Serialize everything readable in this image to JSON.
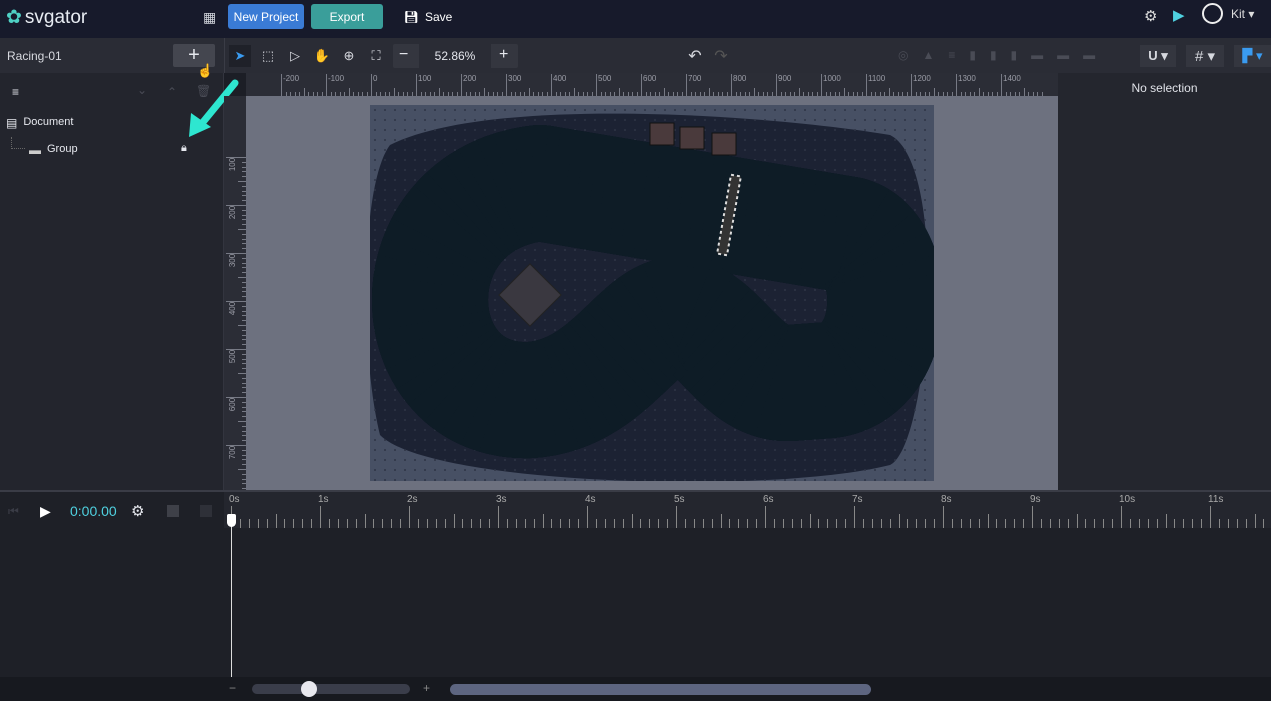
{
  "app": {
    "logo": "svgator",
    "new_project": "New Project",
    "export": "Export",
    "save": "Save",
    "user": "Kit"
  },
  "colors": {
    "accent_blue": "#3a7bd5",
    "accent_teal": "#3a9e9a",
    "time_cyan": "#4fd1e0",
    "arrow": "#2ee6d0"
  },
  "project": {
    "name": "Racing-01",
    "add_label": "+"
  },
  "toolbar": {
    "zoom": "52.86%",
    "zoom_out": "−",
    "zoom_in": "+"
  },
  "layers": [
    {
      "label": "Document"
    },
    {
      "label": "Group",
      "locked": true
    }
  ],
  "right_panel": {
    "status": "No selection"
  },
  "ruler_h": [
    "-200",
    "-100",
    "0",
    "100",
    "200",
    "300",
    "400",
    "500",
    "600",
    "700",
    "800",
    "900",
    "1000",
    "1100",
    "1200",
    "1300",
    "1400"
  ],
  "ruler_v": [
    "100",
    "200",
    "300",
    "400",
    "500",
    "600",
    "700"
  ],
  "timeline": {
    "time": "0:00.00",
    "labels": [
      "0s",
      "1s",
      "2s",
      "3s",
      "4s",
      "5s",
      "6s",
      "7s",
      "8s",
      "9s",
      "10s",
      "11s"
    ]
  },
  "bottom": {
    "minus": "−",
    "plus": "+",
    "zoom_slider": 0.4
  }
}
